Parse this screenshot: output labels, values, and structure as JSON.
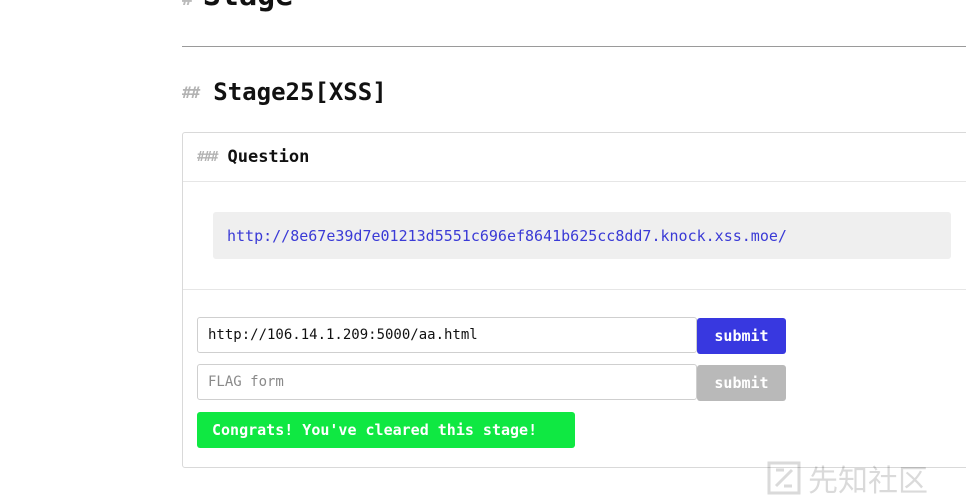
{
  "page": {
    "top_heading_hash": "#",
    "top_heading_text": "Stage",
    "section_hash": "##",
    "section_title": "Stage25[XSS]"
  },
  "card": {
    "header_hash": "###",
    "header_title": "Question",
    "question_url": "http://8e67e39d7e01213d5551c696ef8641b625cc8dd7.knock.xss.moe/"
  },
  "form": {
    "url_input_value": "http://106.14.1.209:5000/aa.html",
    "url_submit_label": "submit",
    "flag_input_value": "",
    "flag_input_placeholder": "FLAG form",
    "flag_submit_label": "submit",
    "status_message": "Congrats! You've cleared this stage!"
  },
  "watermark": {
    "text": "先知社区"
  },
  "colors": {
    "link": "#3a3ad6",
    "submit_active": "#3838e0",
    "submit_disabled": "#b9b9b9",
    "success": "#0fe842"
  }
}
